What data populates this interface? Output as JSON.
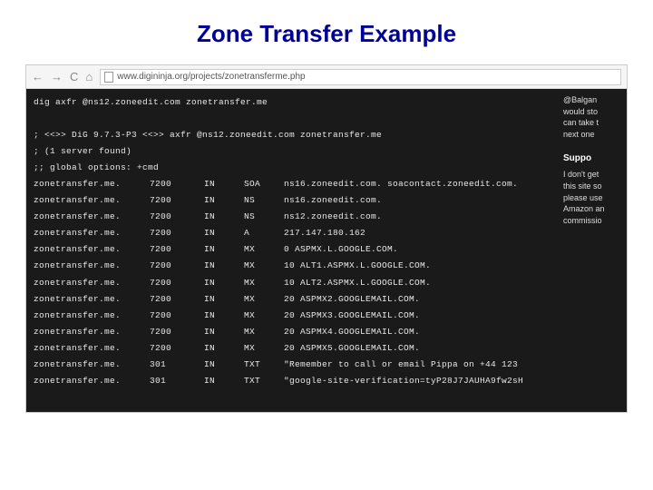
{
  "slide": {
    "title": "Zone Transfer Example"
  },
  "browser": {
    "nav": {
      "back": "←",
      "fwd": "→",
      "reload": "C",
      "home": "⌂"
    },
    "url": "www.digininja.org/projects/zonetransferme.php"
  },
  "terminal": {
    "command": "dig axfr @ns12.zoneedit.com zonetransfer.me",
    "comments": [
      "; <<>> DiG 9.7.3-P3 <<>> axfr @ns12.zoneedit.com zonetransfer.me",
      "; (1 server found)",
      ";; global options: +cmd"
    ],
    "records": [
      {
        "name": "zonetransfer.me.",
        "ttl": "7200",
        "class": "IN",
        "type": "SOA",
        "data": "ns16.zoneedit.com. soacontact.zoneedit.com."
      },
      {
        "name": "zonetransfer.me.",
        "ttl": "7200",
        "class": "IN",
        "type": "NS",
        "data": "ns16.zoneedit.com."
      },
      {
        "name": "zonetransfer.me.",
        "ttl": "7200",
        "class": "IN",
        "type": "NS",
        "data": "ns12.zoneedit.com."
      },
      {
        "name": "zonetransfer.me.",
        "ttl": "7200",
        "class": "IN",
        "type": "A",
        "data": "217.147.180.162"
      },
      {
        "name": "zonetransfer.me.",
        "ttl": "7200",
        "class": "IN",
        "type": "MX",
        "data": "0 ASPMX.L.GOOGLE.COM."
      },
      {
        "name": "zonetransfer.me.",
        "ttl": "7200",
        "class": "IN",
        "type": "MX",
        "data": "10 ALT1.ASPMX.L.GOOGLE.COM."
      },
      {
        "name": "zonetransfer.me.",
        "ttl": "7200",
        "class": "IN",
        "type": "MX",
        "data": "10 ALT2.ASPMX.L.GOOGLE.COM."
      },
      {
        "name": "zonetransfer.me.",
        "ttl": "7200",
        "class": "IN",
        "type": "MX",
        "data": "20 ASPMX2.GOOGLEMAIL.COM."
      },
      {
        "name": "zonetransfer.me.",
        "ttl": "7200",
        "class": "IN",
        "type": "MX",
        "data": "20 ASPMX3.GOOGLEMAIL.COM."
      },
      {
        "name": "zonetransfer.me.",
        "ttl": "7200",
        "class": "IN",
        "type": "MX",
        "data": "20 ASPMX4.GOOGLEMAIL.COM."
      },
      {
        "name": "zonetransfer.me.",
        "ttl": "7200",
        "class": "IN",
        "type": "MX",
        "data": "20 ASPMX5.GOOGLEMAIL.COM."
      },
      {
        "name": "zonetransfer.me.",
        "ttl": "301",
        "class": "IN",
        "type": "TXT",
        "data": "\"Remember to call or email Pippa on +44 123"
      },
      {
        "name": "zonetransfer.me.",
        "ttl": "301",
        "class": "IN",
        "type": "TXT",
        "data": "\"google-site-verification=tyP28J7JAUHA9fw2sH"
      }
    ]
  },
  "sidebar": {
    "blurb": [
      "@Balgan",
      "would sto",
      "can take t",
      "next one"
    ],
    "heading": "Suppo",
    "para": [
      "I don't get",
      "this site so",
      "please use",
      "Amazon an",
      "commissio"
    ]
  }
}
